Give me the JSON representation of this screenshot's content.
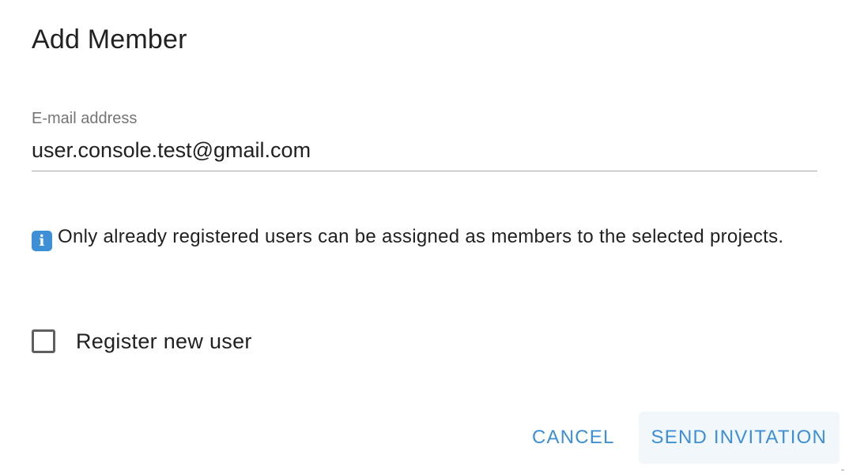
{
  "dialog": {
    "title": "Add Member"
  },
  "email_field": {
    "label": "E-mail address",
    "value": "user.console.test@gmail.com"
  },
  "info": {
    "icon": "info-icon",
    "icon_glyph": "i",
    "text": "Only already registered users can be assigned as members to the selected projects."
  },
  "register_checkbox": {
    "label": "Register new user",
    "checked": false
  },
  "actions": {
    "cancel_label": "CANCEL",
    "send_label": "SEND INVITATION"
  },
  "colors": {
    "accent": "#3d8fd6",
    "text": "#212121",
    "muted": "#757575"
  }
}
